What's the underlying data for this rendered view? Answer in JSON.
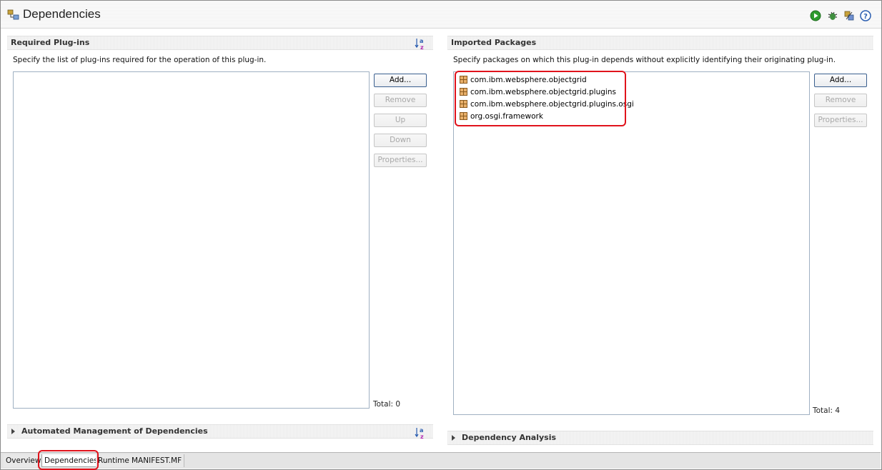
{
  "header": {
    "title": "Dependencies"
  },
  "toolbar": {
    "icons": [
      "run-icon",
      "debug-icon",
      "export-icon",
      "help-icon"
    ],
    "run_color": "#2e9b2e",
    "help_color": "#2a5db0"
  },
  "required": {
    "title": "Required Plug-ins",
    "description": "Specify the list of plug-ins required for the operation of this plug-in.",
    "buttons": {
      "add": "Add...",
      "remove": "Remove",
      "up": "Up",
      "down": "Down",
      "properties": "Properties..."
    },
    "items": [],
    "total": "Total: 0"
  },
  "imported": {
    "title": "Imported Packages",
    "description": "Specify packages on which this plug-in depends without explicitly identifying their originating plug-in.",
    "buttons": {
      "add": "Add...",
      "remove": "Remove",
      "properties": "Properties..."
    },
    "items": [
      "com.ibm.websphere.objectgrid",
      "com.ibm.websphere.objectgrid.plugins",
      "com.ibm.websphere.objectgrid.plugins.osgi",
      "org.osgi.framework"
    ],
    "total": "Total: 4"
  },
  "automated": {
    "title": "Automated Management of Dependencies"
  },
  "analysis": {
    "title": "Dependency Analysis"
  },
  "tabs": {
    "overview": "Overview",
    "dependencies": "Dependencies",
    "runtime": "Runtime",
    "manifest": "MANIFEST.MF"
  },
  "colors": {
    "highlight": "#e0131c",
    "list_border": "#9fb0c2"
  }
}
